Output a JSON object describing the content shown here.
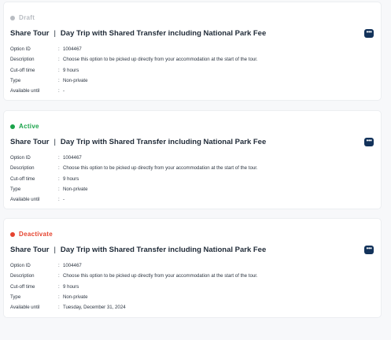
{
  "cards": [
    {
      "status": {
        "label": "Draft",
        "color": "#b8bcc2"
      },
      "title_left": "Share Tour",
      "title_sep": "|",
      "title_right": "Day Trip with Shared Transfer including National Park Fee",
      "more_icon": "more-horizontal-icon",
      "fields": [
        {
          "label": "Option ID",
          "value": "1004467"
        },
        {
          "label": "Description",
          "value": "Choose this option to be picked up directly from your accommodation at the start of the tour."
        },
        {
          "label": "Cut-off time",
          "value": "9 hours"
        },
        {
          "label": "Type",
          "value": "Non-private"
        },
        {
          "label": "Available until",
          "value": "-"
        }
      ]
    },
    {
      "status": {
        "label": "Active",
        "color": "#1aa34a"
      },
      "title_left": "Share Tour",
      "title_sep": "|",
      "title_right": "Day Trip with Shared Transfer including National Park Fee",
      "more_icon": "more-horizontal-icon",
      "fields": [
        {
          "label": "Option ID",
          "value": "1004467"
        },
        {
          "label": "Description",
          "value": "Choose this option to be picked up directly from your accommodation at the start of the tour."
        },
        {
          "label": "Cut-off time",
          "value": "9 hours"
        },
        {
          "label": "Type",
          "value": "Non-private"
        },
        {
          "label": "Available until",
          "value": "-"
        }
      ]
    },
    {
      "status": {
        "label": "Deactivate",
        "color": "#e5432f"
      },
      "title_left": "Share Tour",
      "title_sep": "|",
      "title_right": "Day Trip with Shared Transfer including National Park Fee",
      "more_icon": "more-horizontal-icon",
      "fields": [
        {
          "label": "Option ID",
          "value": "1004467"
        },
        {
          "label": "Description",
          "value": "Choose this option to be picked up directly from your accommodation at the start of the tour."
        },
        {
          "label": "Cut-off time",
          "value": "9 hours"
        },
        {
          "label": "Type",
          "value": "Non-private"
        },
        {
          "label": "Available until",
          "value": "Tuesday, December 31, 2024"
        }
      ]
    }
  ]
}
